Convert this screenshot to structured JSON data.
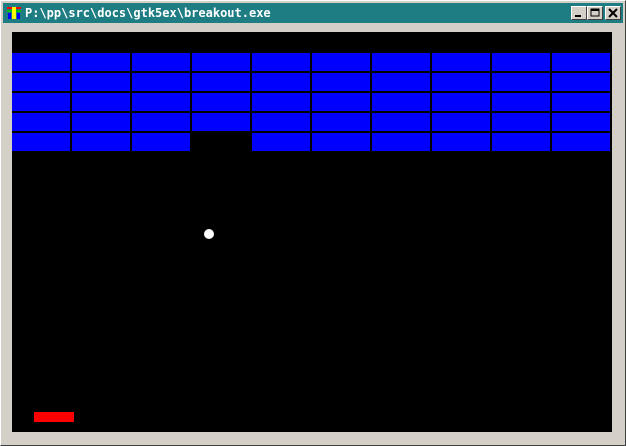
{
  "window": {
    "title": "P:\\pp\\src\\docs\\gtk5ex\\breakout.exe",
    "titlebar_color": "#1e7d83",
    "buttons": [
      "minimize",
      "maximize",
      "close"
    ]
  },
  "game": {
    "background_color": "#000000",
    "brick_color": "#0000ff",
    "ball_color": "#ffffff",
    "paddle_color": "#ff0000",
    "brick_rows": 5,
    "brick_columns": 10,
    "bricks_present": [
      [
        1,
        1,
        1,
        1,
        1,
        1,
        1,
        1,
        1,
        1
      ],
      [
        1,
        1,
        1,
        1,
        1,
        1,
        1,
        1,
        1,
        1
      ],
      [
        1,
        1,
        1,
        1,
        1,
        1,
        1,
        1,
        1,
        1
      ],
      [
        1,
        1,
        1,
        1,
        1,
        1,
        1,
        1,
        1,
        1
      ],
      [
        1,
        1,
        1,
        0,
        1,
        1,
        1,
        1,
        1,
        1
      ]
    ]
  }
}
